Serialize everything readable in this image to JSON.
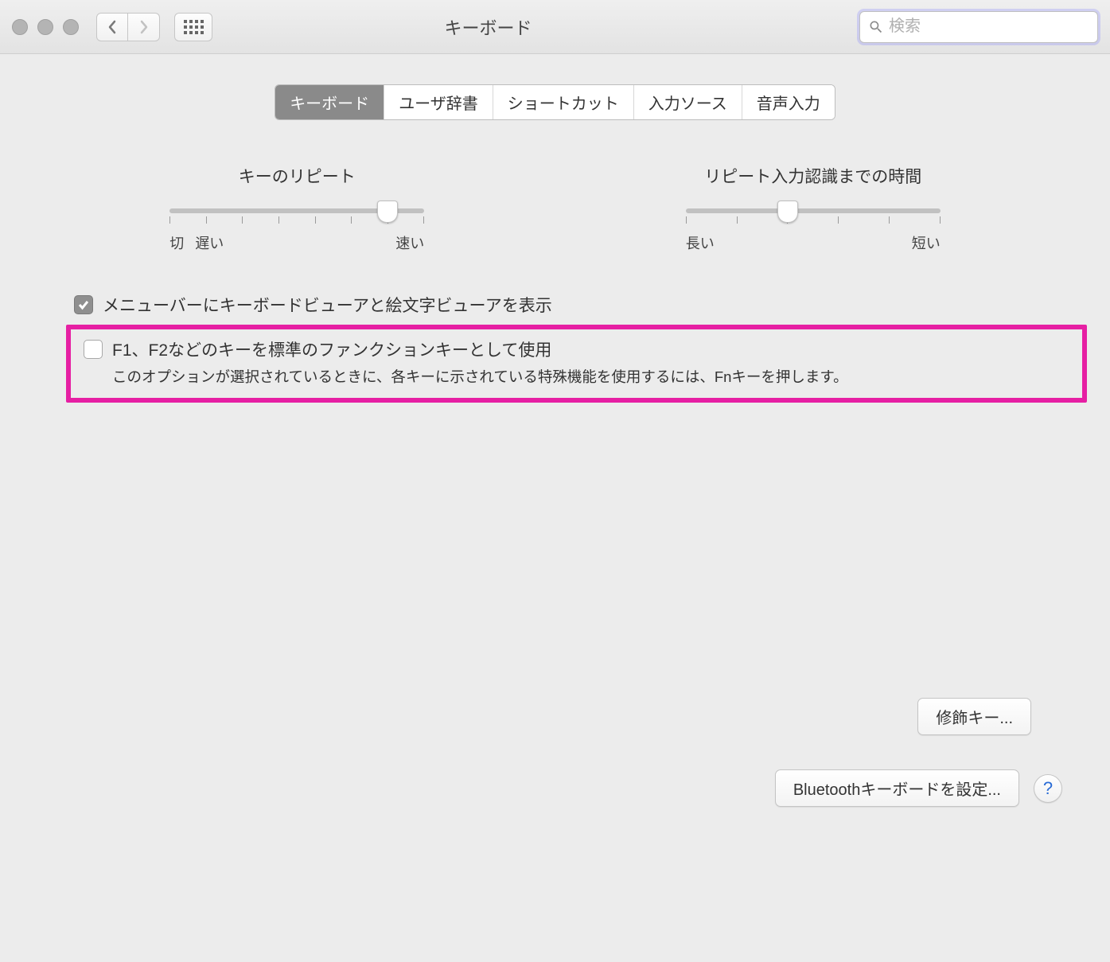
{
  "header": {
    "title": "キーボード",
    "search_placeholder": "検索"
  },
  "tabs": [
    {
      "label": "キーボード",
      "active": true
    },
    {
      "label": "ユーザ辞書",
      "active": false
    },
    {
      "label": "ショートカット",
      "active": false
    },
    {
      "label": "入力ソース",
      "active": false
    },
    {
      "label": "音声入力",
      "active": false
    }
  ],
  "sliders": {
    "key_repeat": {
      "title": "キーのリピート",
      "off_label": "切",
      "min_label": "遅い",
      "max_label": "速い",
      "ticks": 8,
      "value_index": 6
    },
    "delay_until_repeat": {
      "title": "リピート入力認識までの時間",
      "min_label": "長い",
      "max_label": "短い",
      "ticks": 6,
      "value_index": 2
    }
  },
  "checkboxes": {
    "show_viewers": {
      "label": "メニューバーにキーボードビューアと絵文字ビューアを表示",
      "checked": true
    },
    "fn_keys": {
      "label": "F1、F2などのキーを標準のファンクションキーとして使用",
      "description": "このオプションが選択されているときに、各キーに示されている特殊機能を使用するには、Fnキーを押します。",
      "checked": false
    }
  },
  "buttons": {
    "modifier_keys": "修飾キー...",
    "bluetooth_setup": "Bluetoothキーボードを設定...",
    "help": "?"
  }
}
